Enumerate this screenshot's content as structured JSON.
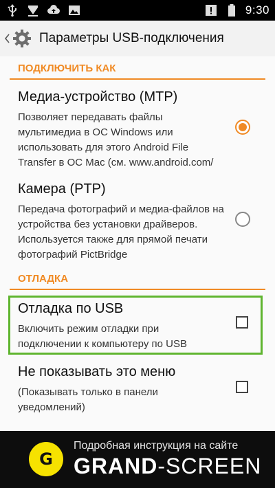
{
  "status_bar": {
    "time": "9:30",
    "left_icons": [
      "usb-icon",
      "download-icon",
      "cloud-upload-icon",
      "image-icon"
    ],
    "right_icons": [
      "alert-icon",
      "battery-icon"
    ]
  },
  "action_bar": {
    "title": "Параметры USB-подключения",
    "icon": "settings-gear-icon"
  },
  "sections": [
    {
      "header": "ПОДКЛЮЧИТЬ КАК",
      "items": [
        {
          "title": "Медиа-устройство (MTP)",
          "summary": "Позволяет передавать файлы мультимедиа в ОС Windows или использовать для этого Android File Transfer в ОС Mac (см. www.android.com/",
          "control": "radio",
          "checked": true
        },
        {
          "title": "Камера (PTP)",
          "summary": "Передача фотографий и медиа-файлов на устройства без установки драйверов. Используется также для прямой печати фотографий PictBridge",
          "control": "radio",
          "checked": false
        }
      ]
    },
    {
      "header": "ОТЛАДКА",
      "items": [
        {
          "title": "Отладка по USB",
          "summary": "Включить режим отладки при подключении к компьютеру по USB",
          "control": "checkbox",
          "checked": false
        },
        {
          "title": "Не показывать это меню",
          "summary": "(Показывать только в панели уведомлений)",
          "control": "checkbox",
          "checked": false
        }
      ]
    }
  ],
  "banner": {
    "logo_letter": "G",
    "subtitle": "Подробная инструкция на сайте",
    "brand_bold": "GRAND",
    "brand_dash": "-",
    "brand_rest": "SCREEN"
  },
  "colors": {
    "accent": "#f08a24",
    "highlight": "#5fb52f",
    "logo": "#f6e200"
  }
}
